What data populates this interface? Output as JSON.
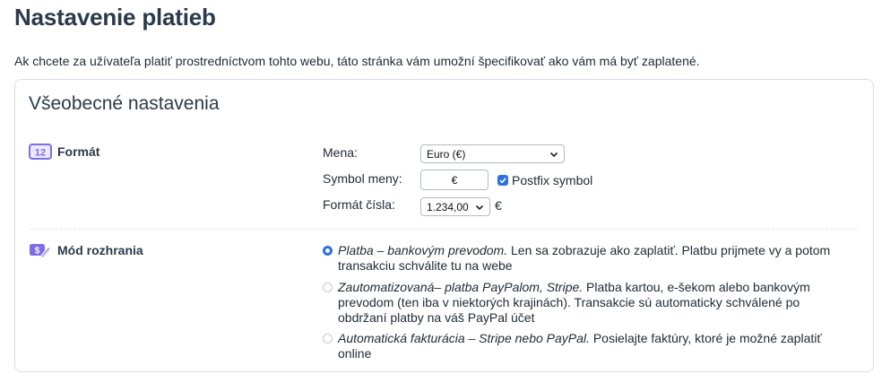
{
  "page": {
    "title": "Nastavenie platieb",
    "description": "Ak chcete za užívateľa platiť prostredníctvom tohto webu, táto stránka vám umožní špecifikovať ako vám má byť zaplatené."
  },
  "general": {
    "title": "Všeobecné nastavenia",
    "format": {
      "label": "Formát",
      "icon": "number-12-icon",
      "icon_text": "12",
      "currency_label": "Mena:",
      "currency_value": "Euro (€)",
      "symbol_label": "Symbol  meny:",
      "symbol_value": "€",
      "postfix_label": "Postfix symbol",
      "postfix_checked": true,
      "number_format_label": "Formát čísla:",
      "number_format_value": "1.234,00",
      "number_format_suffix": "€"
    },
    "interface_mode": {
      "label": "Mód rozhrania",
      "icon": "payment-edit-icon",
      "options": [
        {
          "title": "Platba – bankovým prevodom.",
          "text": " Len sa zobrazuje ako zaplatiť. Platbu prijmete vy a potom transakciu schválite tu na webe",
          "checked": true
        },
        {
          "title": "Zautomatizovaná– platba PayPalom, Stripe.",
          "text": " Platba kartou, e-šekom alebo bankovým prevodom (ten iba v niektorých krajinách). Transakcie sú automaticky schválené po obdržaní platby na váš PayPal účet",
          "checked": false
        },
        {
          "title": "Automatická fakturácia – Stripe nebo PayPal.",
          "text": " Posielajte faktúry, ktoré je možné zaplatiť online",
          "checked": false
        }
      ]
    }
  },
  "colors": {
    "accent": "#2f6fe0",
    "icon_purple": "#7b6ee6"
  }
}
